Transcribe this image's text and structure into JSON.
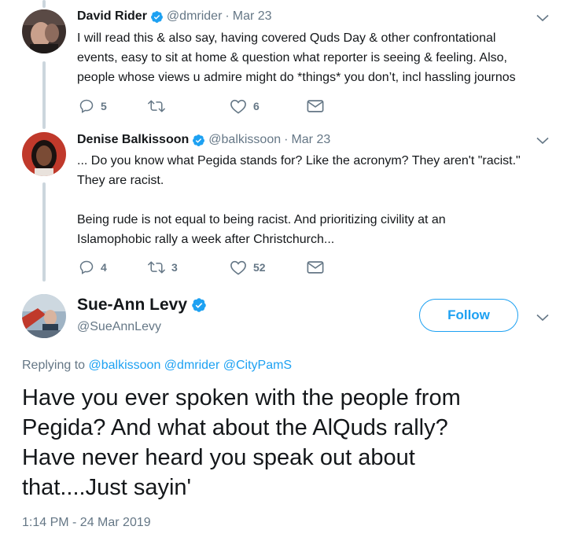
{
  "tweets": [
    {
      "name": "David Rider",
      "handle": "@dmrider",
      "sep": "·",
      "date": "Mar 23",
      "lines": [
        "I will read this & also say, having covered Quds Day & other confrontational",
        "events, easy to sit at home & question what reporter is seeing & feeling. Also,",
        "people whose views u admire might do *things* you don’t, incl hassling journos"
      ],
      "replies": "5",
      "retweets": "",
      "likes": "6"
    },
    {
      "name": "Denise Balkissoon",
      "handle": "@balkissoon",
      "sep": "·",
      "date": "Mar 23",
      "lines": [
        "... Do you know what Pegida stands for? Like the acronym? They aren't \"racist.\"",
        "They are racist.",
        "",
        "Being rude is not equal to being racist. And prioritizing civility at an",
        "Islamophobic rally a week after Christchurch..."
      ],
      "replies": "4",
      "retweets": "3",
      "likes": "52"
    }
  ],
  "main": {
    "name": "Sue-Ann Levy",
    "handle": "@SueAnnLevy",
    "follow_label": "Follow",
    "replying_prefix": "Replying to",
    "replying_to": [
      "@balkissoon",
      "@dmrider",
      "@CityPamS"
    ],
    "lines": [
      "Have you ever spoken with the people from",
      "Pegida? And what about the AlQuds rally?",
      "Have never heard you speak out about",
      "that....Just sayin'"
    ],
    "timestamp": "1:14 PM - 24 Mar 2019"
  },
  "colors": {
    "accent": "#1da1f2",
    "muted": "#657786",
    "thread": "#ccd6dd"
  }
}
